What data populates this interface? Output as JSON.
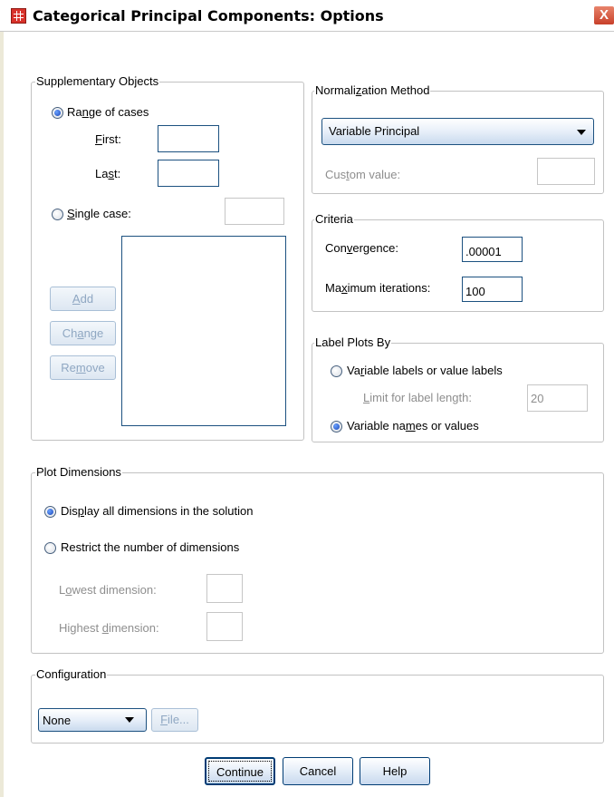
{
  "window": {
    "title": "Categorical Principal Components: Options",
    "close_label": "X",
    "icon": "spss-grid-icon"
  },
  "supplementary_objects": {
    "legend": "Supplementary Objects",
    "range_of_cases": {
      "label": "Range of cases",
      "selected": true
    },
    "first_label": "First:",
    "first_value": "",
    "last_label": "Last:",
    "last_value": "",
    "single_case": {
      "label": "Single case:",
      "selected": false
    },
    "single_case_value": "",
    "add_label": "Add",
    "change_label": "Change",
    "remove_label": "Remove"
  },
  "normalization": {
    "legend": "Normalization Method",
    "selected": "Variable Principal",
    "custom_label": "Custom value:",
    "custom_value": ""
  },
  "criteria": {
    "legend": "Criteria",
    "convergence_label": "Convergence:",
    "convergence_value": ".00001",
    "max_iter_label": "Maximum iterations:",
    "max_iter_value": "100"
  },
  "label_plots": {
    "legend": "Label Plots By",
    "var_labels": {
      "label": "Variable labels or value labels",
      "selected": false
    },
    "limit_label": "Limit for label length:",
    "limit_value": "20",
    "var_names": {
      "label": "Variable names or values",
      "selected": true
    }
  },
  "plot_dimensions": {
    "legend": "Plot Dimensions",
    "display_all": {
      "label": "Display all dimensions in the solution",
      "selected": true
    },
    "restrict": {
      "label": "Restrict the number of dimensions",
      "selected": false
    },
    "lowest_label": "Lowest dimension:",
    "lowest_value": "",
    "highest_label": "Highest dimension:",
    "highest_value": ""
  },
  "configuration": {
    "legend": "Configuration",
    "selected": "None",
    "file_label": "File..."
  },
  "footer": {
    "continue_label": "Continue",
    "cancel_label": "Cancel",
    "help_label": "Help"
  }
}
